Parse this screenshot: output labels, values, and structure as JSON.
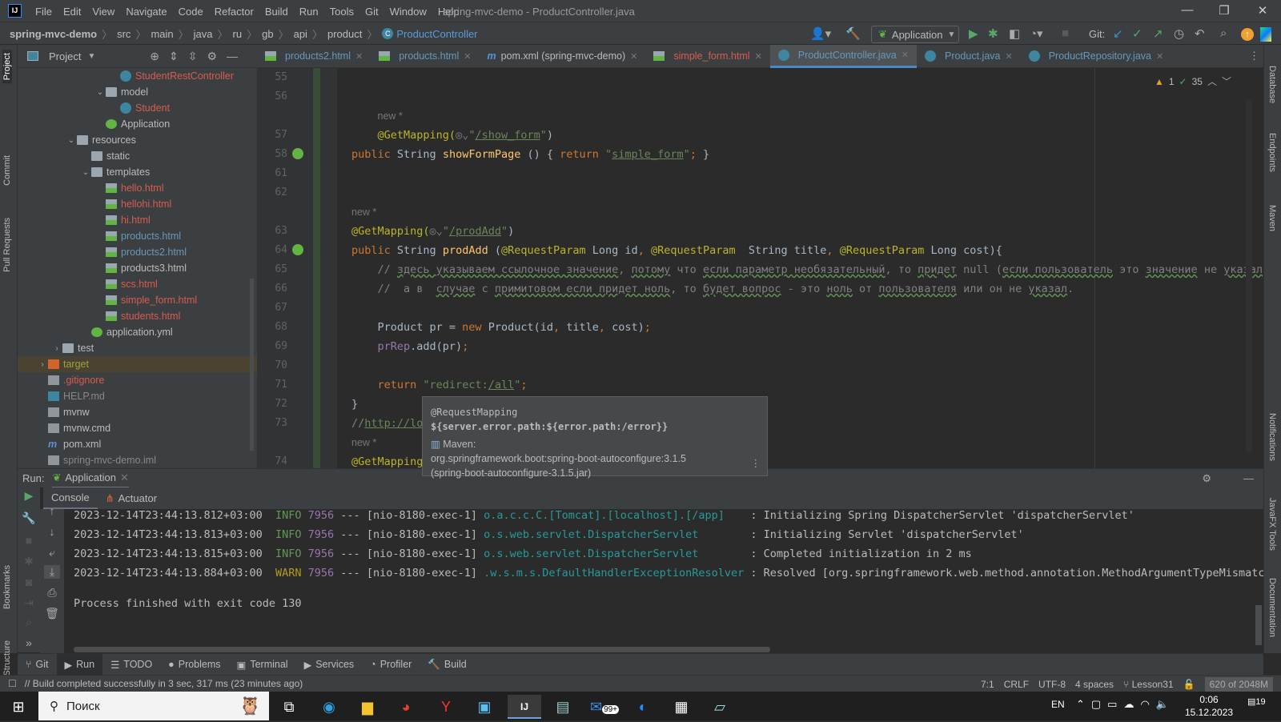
{
  "titlebar": {
    "menu": [
      "File",
      "Edit",
      "View",
      "Navigate",
      "Code",
      "Refactor",
      "Build",
      "Run",
      "Tools",
      "Git",
      "Window",
      "Help"
    ],
    "title": "spring-mvc-demo - ProductController.java",
    "logo": "IJ"
  },
  "navbar": {
    "crumbs": [
      "spring-mvc-demo",
      "src",
      "main",
      "java",
      "ru",
      "gb",
      "api",
      "product"
    ],
    "current": "ProductController",
    "run_config": "Application",
    "git_label": "Git:"
  },
  "left_strip": [
    "Project",
    "Commit",
    "Pull Requests",
    "Bookmarks",
    "Structure"
  ],
  "right_strip": [
    "Database",
    "Endpoints",
    "Maven",
    "Notifications",
    "JavaFX Tools",
    "Documentation"
  ],
  "project": {
    "title": "Project",
    "items": [
      {
        "label": "StudentRestController",
        "indent": 6,
        "icon": "class",
        "color": "red"
      },
      {
        "label": "model",
        "indent": 5,
        "icon": "folder",
        "expanded": true,
        "color": "default"
      },
      {
        "label": "Student",
        "indent": 6,
        "icon": "class",
        "color": "red"
      },
      {
        "label": "Application",
        "indent": 5,
        "icon": "spring-app",
        "color": "default"
      },
      {
        "label": "resources",
        "indent": 3,
        "icon": "folder",
        "expanded": true,
        "color": "default"
      },
      {
        "label": "static",
        "indent": 4,
        "icon": "folder",
        "color": "default"
      },
      {
        "label": "templates",
        "indent": 4,
        "icon": "folder",
        "expanded": true,
        "color": "default"
      },
      {
        "label": "hello.html",
        "indent": 5,
        "icon": "html",
        "color": "red"
      },
      {
        "label": "hellohi.html",
        "indent": 5,
        "icon": "html",
        "color": "red"
      },
      {
        "label": "hi.html",
        "indent": 5,
        "icon": "html",
        "color": "red"
      },
      {
        "label": "products.html",
        "indent": 5,
        "icon": "html",
        "color": "cyan"
      },
      {
        "label": "products2.html",
        "indent": 5,
        "icon": "html",
        "color": "cyan"
      },
      {
        "label": "products3.html",
        "indent": 5,
        "icon": "html",
        "color": "default"
      },
      {
        "label": "scs.html",
        "indent": 5,
        "icon": "html",
        "color": "red"
      },
      {
        "label": "simple_form.html",
        "indent": 5,
        "icon": "html",
        "color": "red"
      },
      {
        "label": "students.html",
        "indent": 5,
        "icon": "html",
        "color": "red"
      },
      {
        "label": "application.yml",
        "indent": 4,
        "icon": "spring-yml",
        "color": "default"
      },
      {
        "label": "test",
        "indent": 2,
        "icon": "folder",
        "collapsed": true,
        "color": "default"
      },
      {
        "label": "target",
        "indent": 1,
        "icon": "folder-excluded",
        "collapsed": true,
        "color": "olive",
        "selected": true
      },
      {
        "label": ".gitignore",
        "indent": 1,
        "icon": "file",
        "color": "red"
      },
      {
        "label": "HELP.md",
        "indent": 1,
        "icon": "md",
        "color": "gray"
      },
      {
        "label": "mvnw",
        "indent": 1,
        "icon": "file",
        "color": "default"
      },
      {
        "label": "mvnw.cmd",
        "indent": 1,
        "icon": "file",
        "color": "default"
      },
      {
        "label": "pom.xml",
        "indent": 1,
        "icon": "maven",
        "color": "default"
      },
      {
        "label": "spring-mvc-demo.iml",
        "indent": 1,
        "icon": "file",
        "color": "gray"
      }
    ]
  },
  "tabs": [
    {
      "label": "products2.html",
      "icon": "html",
      "color": "cyan"
    },
    {
      "label": "products.html",
      "icon": "html",
      "color": "cyan"
    },
    {
      "label": "pom.xml (spring-mvc-demo)",
      "icon": "maven",
      "color": "default"
    },
    {
      "label": "simple_form.html",
      "icon": "html",
      "color": "red"
    },
    {
      "label": "ProductController.java",
      "icon": "class",
      "color": "cyan",
      "active": true
    },
    {
      "label": "Product.java",
      "icon": "class",
      "color": "cyan"
    },
    {
      "label": "ProductRepository.java",
      "icon": "class",
      "color": "cyan"
    }
  ],
  "inspections": {
    "warnings": "1",
    "ok": "35"
  },
  "code": [
    {
      "n": "55",
      "t": []
    },
    {
      "n": "56",
      "t": []
    },
    {
      "n": "",
      "t": [
        [
          "    ",
          ""
        ],
        [
          "new *",
          "hint"
        ]
      ]
    },
    {
      "n": "57",
      "t": [
        [
          "    ",
          ""
        ],
        [
          "@GetMapping(",
          "a"
        ],
        [
          "◎⌄",
          "c"
        ],
        [
          "\"",
          "s"
        ],
        [
          "/show_form",
          "u"
        ],
        [
          "\"",
          "s"
        ],
        [
          ")",
          "w"
        ]
      ]
    },
    {
      "n": "58",
      "t": [
        [
          "public ",
          "k"
        ],
        [
          "String ",
          "w"
        ],
        [
          "showFormPage ",
          "f"
        ],
        [
          "() { ",
          "w"
        ],
        [
          "return ",
          "k"
        ],
        [
          "\"",
          "s"
        ],
        [
          "simple_form",
          "u"
        ],
        [
          "\"",
          "s"
        ],
        [
          "; ",
          "k"
        ],
        [
          "}",
          "w"
        ]
      ]
    },
    {
      "n": "61",
      "t": []
    },
    {
      "n": "62",
      "t": []
    },
    {
      "n": "",
      "t": [
        [
          "new *",
          "hint"
        ]
      ]
    },
    {
      "n": "63",
      "t": [
        [
          "@GetMapping(",
          "a"
        ],
        [
          "◎⌄",
          "c"
        ],
        [
          "\"",
          "s"
        ],
        [
          "/prodAdd",
          "u"
        ],
        [
          "\"",
          "s"
        ],
        [
          ")",
          "w"
        ]
      ]
    },
    {
      "n": "64",
      "t": [
        [
          "public ",
          "k"
        ],
        [
          "String ",
          "w"
        ],
        [
          "prodAdd ",
          "f"
        ],
        [
          "(",
          "w"
        ],
        [
          "@RequestParam ",
          "a"
        ],
        [
          "Long id",
          ""
        ],
        [
          ", ",
          "k"
        ],
        [
          "@RequestParam ",
          "a"
        ],
        [
          " String title",
          ""
        ],
        [
          ", ",
          "k"
        ],
        [
          "@RequestParam ",
          "a"
        ],
        [
          "Long cost){",
          ""
        ]
      ]
    },
    {
      "n": "65",
      "t": [
        [
          "    // ",
          "c"
        ],
        [
          "здесь указываем ссылочное значение",
          "cu"
        ],
        [
          ", ",
          "c"
        ],
        [
          "потому",
          "cu"
        ],
        [
          " что ",
          "c"
        ],
        [
          "если параметр необязательный",
          "cu"
        ],
        [
          ", то ",
          "c"
        ],
        [
          "придет",
          "cu"
        ],
        [
          " null (",
          "c"
        ],
        [
          "если пользователь",
          "cu"
        ],
        [
          " это ",
          "c"
        ],
        [
          "значение",
          "cu"
        ],
        [
          " не ",
          "c"
        ],
        [
          "указал",
          "cu"
        ],
        [
          ").",
          "c"
        ]
      ]
    },
    {
      "n": "66",
      "t": [
        [
          "    //  а в  ",
          "c"
        ],
        [
          "случае",
          "cu"
        ],
        [
          " с ",
          "c"
        ],
        [
          "примитовом если придет ноль",
          "cu"
        ],
        [
          ", то ",
          "c"
        ],
        [
          "будет вопрос",
          "cu"
        ],
        [
          " - это ",
          "c"
        ],
        [
          "ноль",
          "cu"
        ],
        [
          " от ",
          "c"
        ],
        [
          "пользователя",
          "cu"
        ],
        [
          " или он не ",
          "c"
        ],
        [
          "указал",
          "cu"
        ],
        [
          ".",
          "c"
        ]
      ]
    },
    {
      "n": "67",
      "t": []
    },
    {
      "n": "68",
      "t": [
        [
          "    Product pr = ",
          ""
        ],
        [
          "new ",
          "k"
        ],
        [
          "Product(id",
          ""
        ],
        [
          ", ",
          "k"
        ],
        [
          "title",
          ""
        ],
        [
          ", ",
          "k"
        ],
        [
          "cost)",
          ""
        ],
        [
          ";",
          "k"
        ]
      ]
    },
    {
      "n": "69",
      "t": [
        [
          "    ",
          ""
        ],
        [
          "prRep",
          "p"
        ],
        [
          ".add(pr)",
          ""
        ],
        [
          ";",
          "k"
        ]
      ]
    },
    {
      "n": "70",
      "t": []
    },
    {
      "n": "71",
      "t": [
        [
          "    ",
          ""
        ],
        [
          "return ",
          "k"
        ],
        [
          "\"redirect:",
          "s"
        ],
        [
          "/all",
          "u"
        ],
        [
          "\"",
          "s"
        ],
        [
          ";",
          "k"
        ]
      ]
    },
    {
      "n": "72",
      "t": [
        [
          "}",
          ""
        ]
      ]
    },
    {
      "n": "73",
      "t": [
        [
          "//",
          "c"
        ],
        [
          "http://lo",
          "u"
        ]
      ]
    },
    {
      "n": "",
      "t": [
        [
          "new *",
          "hint"
        ]
      ]
    },
    {
      "n": "74",
      "t": [
        [
          "@GetMapping",
          "a"
        ]
      ]
    }
  ],
  "tooltip": {
    "annotation": "@RequestMapping",
    "value": "${server.error.path:${error.path:/error}}",
    "source_label": "Maven:",
    "artifact": "org.springframework.boot:spring-boot-autoconfigure:3.1.5",
    "jar": "(spring-boot-autoconfigure-3.1.5.jar)"
  },
  "run": {
    "label": "Run:",
    "config": "Application",
    "tabs": [
      "Console",
      "Actuator"
    ]
  },
  "console": [
    {
      "ts": "2023-12-14T23:44:13.812+03:00",
      "level": "INFO",
      "pid": "7956",
      "sep": "---",
      "thread": "[nio-8180-exec-1]",
      "logger": "o.a.c.c.C.[Tomcat].[localhost].[/app]   ",
      "msg": ": Initializing Spring DispatcherServlet 'dispatcherServlet'"
    },
    {
      "ts": "2023-12-14T23:44:13.813+03:00",
      "level": "INFO",
      "pid": "7956",
      "sep": "---",
      "thread": "[nio-8180-exec-1]",
      "logger": "o.s.web.servlet.DispatcherServlet       ",
      "msg": ": Initializing Servlet 'dispatcherServlet'"
    },
    {
      "ts": "2023-12-14T23:44:13.815+03:00",
      "level": "INFO",
      "pid": "7956",
      "sep": "---",
      "thread": "[nio-8180-exec-1]",
      "logger": "o.s.web.servlet.DispatcherServlet       ",
      "msg": ": Completed initialization in 2 ms"
    },
    {
      "ts": "2023-12-14T23:44:13.884+03:00",
      "level": "WARN",
      "pid": "7956",
      "sep": "---",
      "thread": "[nio-8180-exec-1]",
      "logger": ".w.s.m.s.DefaultHandlerExceptionResolver",
      "msg": ": Resolved [org.springframework.web.method.annotation.MethodArgumentTypeMismatchEx"
    }
  ],
  "process_exit": "Process finished with exit code 130",
  "bottom_tabs": [
    "Git",
    "Run",
    "TODO",
    "Problems",
    "Terminal",
    "Services",
    "Profiler",
    "Build"
  ],
  "status": {
    "message": "// Build completed successfully in 3 sec, 317 ms (23 minutes ago)",
    "position": "7:1",
    "line_sep": "CRLF",
    "encoding": "UTF-8",
    "indent": "4 spaces",
    "branch": "Lesson31",
    "memory": "620 of 2048M"
  },
  "taskbar": {
    "search_placeholder": "Поиск",
    "lang": "EN",
    "time": "0:06",
    "date": "15.12.2023",
    "notifications": "19",
    "mail_badge": "99+"
  }
}
